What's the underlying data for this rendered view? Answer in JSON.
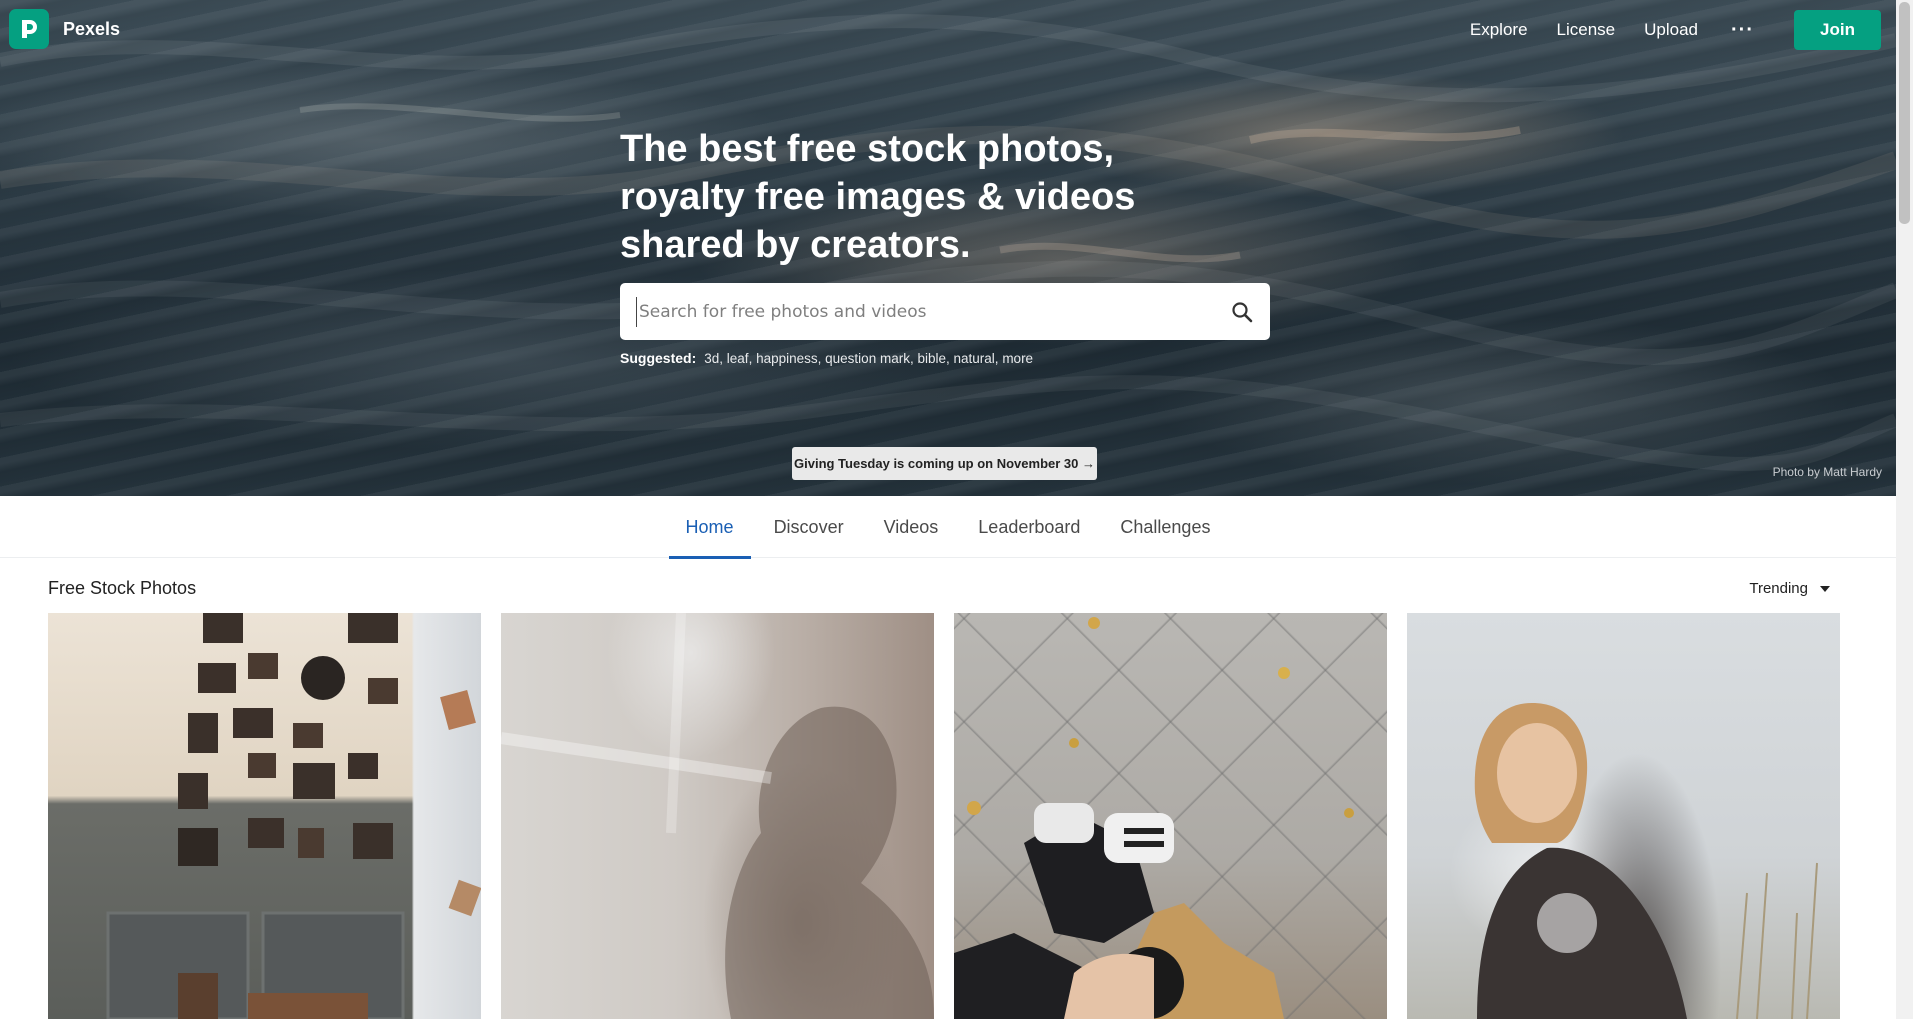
{
  "brand": {
    "name": "Pexels",
    "logo_letter": "P"
  },
  "nav": {
    "links": [
      "Explore",
      "License",
      "Upload"
    ],
    "more_label": "···",
    "join_label": "Join"
  },
  "hero": {
    "title": "The best free stock photos, royalty free images & videos shared by creators.",
    "search_placeholder": "Search for free photos and videos",
    "search_value": "",
    "suggested_label": "Suggested:",
    "suggested_tags": [
      "3d",
      "leaf",
      "happiness",
      "question mark",
      "bible",
      "natural",
      "more"
    ],
    "banner_text": "Giving Tuesday is coming up on November 30 →",
    "photo_credit": "Photo by Matt Hardy"
  },
  "tabs": [
    {
      "label": "Home",
      "active": true
    },
    {
      "label": "Discover",
      "active": false
    },
    {
      "label": "Videos",
      "active": false
    },
    {
      "label": "Leaderboard",
      "active": false
    },
    {
      "label": "Challenges",
      "active": false
    }
  ],
  "section": {
    "title": "Free Stock Photos",
    "sort_value": "Trending"
  },
  "colors": {
    "brand_green": "#05a081",
    "active_tab": "#1a5fb4"
  },
  "icons": {
    "search": "search-icon",
    "caret": "chevron-down-icon",
    "logo": "pexels-logo-icon"
  }
}
